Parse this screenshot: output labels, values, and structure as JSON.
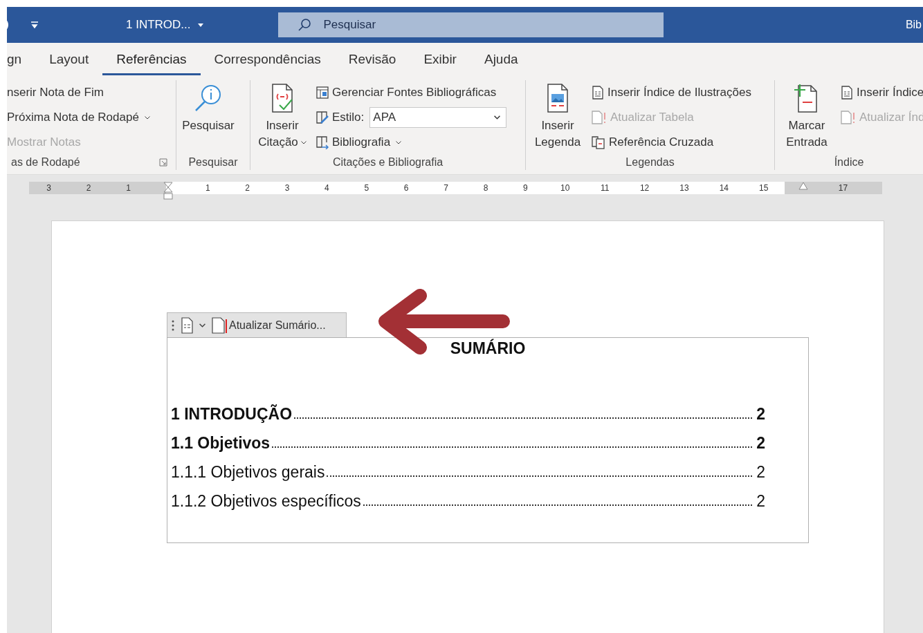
{
  "title_bar": {
    "document_title": "1 INTROD...",
    "search": {
      "placeholder": "Pesquisar"
    },
    "right_text": "Bib"
  },
  "tabs": [
    {
      "label": "gn",
      "selected": false
    },
    {
      "label": "Layout",
      "selected": false
    },
    {
      "label": "Referências",
      "selected": true
    },
    {
      "label": "Correspondências",
      "selected": false
    },
    {
      "label": "Revisão",
      "selected": false
    },
    {
      "label": "Exibir",
      "selected": false
    },
    {
      "label": "Ajuda",
      "selected": false
    }
  ],
  "ribbon": {
    "groups": [
      {
        "items": [
          {
            "kind": "button",
            "label": "nserir Nota de Fim",
            "disabled": false,
            "dropdown": false
          },
          {
            "kind": "button",
            "label": "Próxima Nota de Rodapé",
            "disabled": false,
            "dropdown": true
          },
          {
            "kind": "button",
            "label": "Mostrar Notas",
            "disabled": true,
            "dropdown": false
          }
        ],
        "group_label": "as de Rodapé"
      },
      {
        "big_button": {
          "label": "Pesquisar",
          "dropdown": false
        },
        "group_label": "Pesquisar"
      },
      {
        "big_button": {
          "label": "Inserir Citação",
          "dropdown": true
        },
        "items": [
          {
            "kind": "button",
            "label": "Gerenciar Fontes Bibliográficas",
            "disabled": false,
            "dropdown": false
          },
          {
            "kind": "select",
            "label": "Estilo:",
            "value": "APA"
          },
          {
            "kind": "button",
            "label": "Bibliografia",
            "disabled": false,
            "dropdown": true
          }
        ],
        "group_label": "Citações e Bibliografia"
      },
      {
        "big_button": {
          "label": "Inserir Legenda",
          "dropdown": false
        },
        "items": [
          {
            "kind": "button",
            "label": "Inserir Índice de Ilustrações",
            "disabled": false,
            "dropdown": false
          },
          {
            "kind": "button",
            "label": "Atualizar Tabela",
            "disabled": true,
            "dropdown": false
          },
          {
            "kind": "button",
            "label": "Referência Cruzada",
            "disabled": false,
            "dropdown": false
          }
        ],
        "group_label": "Legendas"
      },
      {
        "big_button": {
          "label": "Marcar Entrada",
          "dropdown": false
        },
        "items": [
          {
            "kind": "button",
            "label": "Inserir Índice",
            "disabled": false
          },
          {
            "kind": "button",
            "label": "Atualizar Índ",
            "disabled": true
          }
        ],
        "group_label": "Índice"
      }
    ]
  },
  "ruler": {
    "left_labels": [
      "3",
      "2",
      "1"
    ],
    "right_labels": [
      "1",
      "2",
      "3",
      "4",
      "5",
      "6",
      "7",
      "8",
      "9",
      "10",
      "11",
      "12",
      "13",
      "14",
      "15"
    ],
    "end_labels": [
      "17"
    ]
  },
  "document": {
    "toc_toolbar": {
      "update_button": "Atualizar Sumário..."
    },
    "toc": {
      "heading": "SUMÁRIO",
      "entries": [
        {
          "text": "1 INTRODUÇÃO",
          "page": "2",
          "bold": true
        },
        {
          "text": "1.1 Objetivos",
          "page": "2",
          "bold": true
        },
        {
          "text": "1.1.1 Objetivos gerais",
          "page": "2",
          "bold": false
        },
        {
          "text": "1.1.2 Objetivos específicos",
          "page": "2",
          "bold": false
        }
      ]
    }
  }
}
